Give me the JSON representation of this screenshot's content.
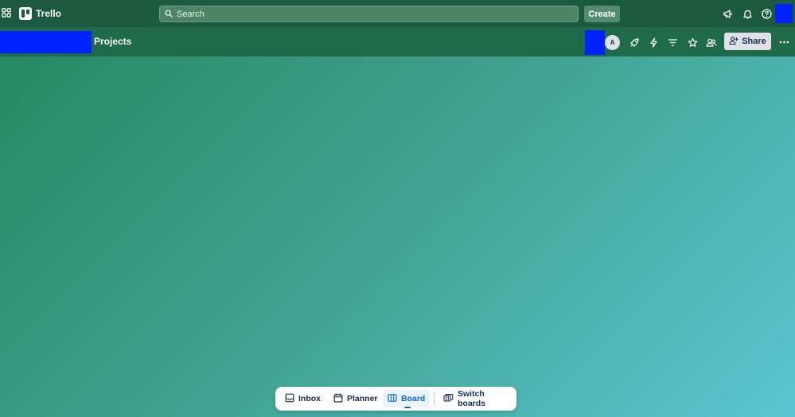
{
  "topbar": {
    "app_name": "Trello",
    "search_placeholder": "Search",
    "create_label": "Create"
  },
  "board": {
    "title": "Projects",
    "member_initial": "A",
    "share_label": "Share"
  },
  "bottom_nav": {
    "items": [
      {
        "label": "Inbox"
      },
      {
        "label": "Planner"
      },
      {
        "label": "Board"
      },
      {
        "label": "Switch boards"
      }
    ],
    "active": "Board"
  },
  "colors": {
    "topbar_bg": "#1c5a3f",
    "header_bg": "#1f6a48",
    "gradient_start": "#23875f",
    "gradient_end": "#5bc6d2",
    "redaction": "#0022ff",
    "active_blue": "#0c66e4"
  },
  "icons": {
    "apps": "grid-icon",
    "logo": "trello-logo",
    "search": "search-icon",
    "announcements": "megaphone-icon",
    "notifications": "bell-icon",
    "help": "help-icon",
    "power_ups": "rocket-icon",
    "automation": "lightning-icon",
    "filter": "filter-icon",
    "star": "star-icon",
    "visibility": "team-visibility-icon",
    "share": "add-person-icon",
    "more": "more-icon",
    "inbox": "inbox-icon",
    "planner": "calendar-icon",
    "board": "board-icon",
    "switch": "switch-boards-icon"
  }
}
